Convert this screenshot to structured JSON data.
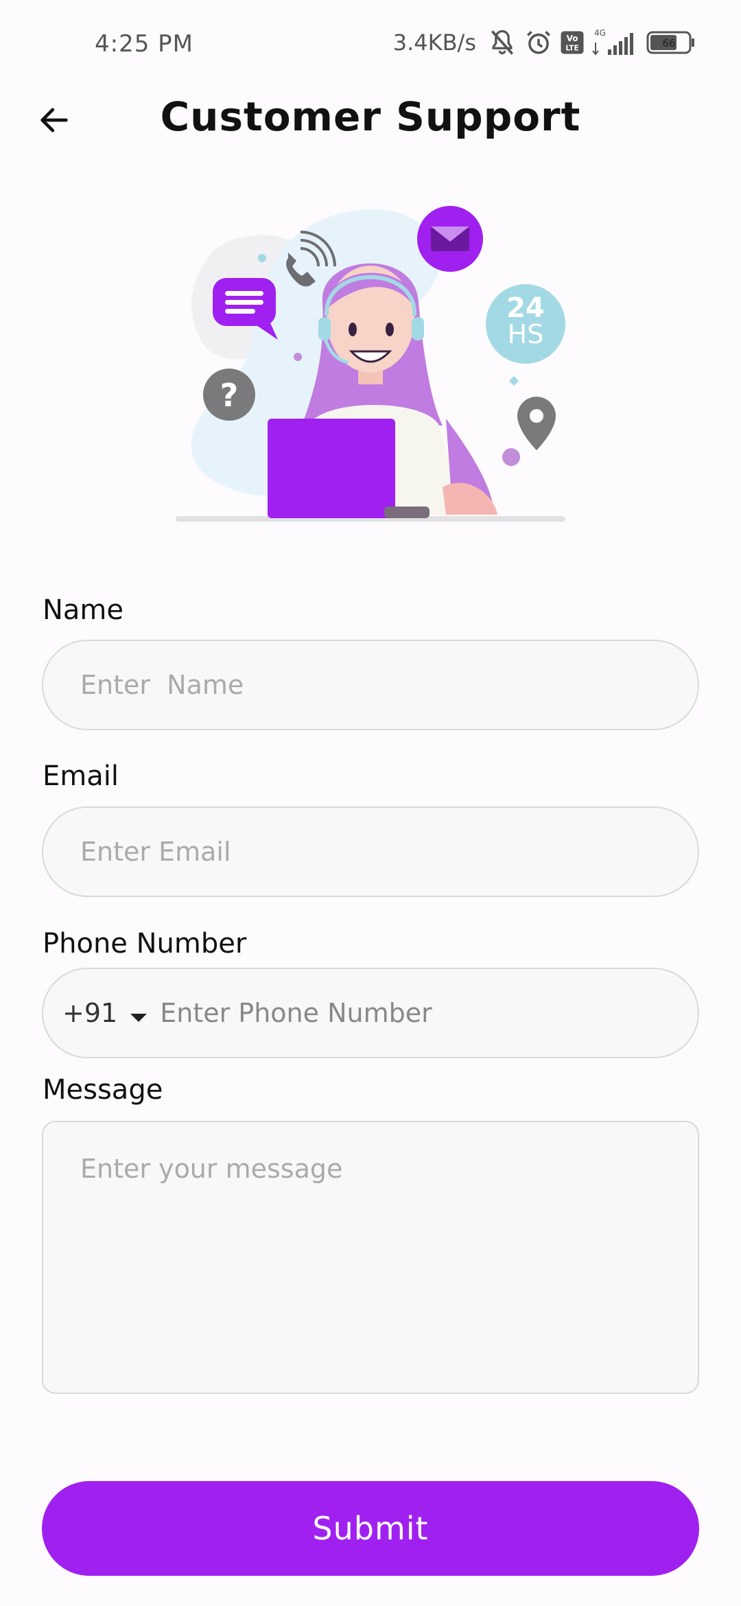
{
  "status_bar": {
    "time": "4:25 PM",
    "net_speed": "3.4KB/s",
    "network_type": "4G",
    "volte_label": "Vo LTE",
    "battery_level": "66"
  },
  "header": {
    "title": "Customer Support"
  },
  "illustration": {
    "badge_top": "24",
    "badge_bottom": "HS",
    "question_mark": "?"
  },
  "form": {
    "name": {
      "label": "Name",
      "placeholder": "Enter  Name",
      "value": ""
    },
    "email": {
      "label": "Email",
      "placeholder": "Enter Email",
      "value": ""
    },
    "phone": {
      "label": "Phone Number",
      "country_code": "+91",
      "placeholder": "Enter Phone Number",
      "value": ""
    },
    "message": {
      "label": "Message",
      "placeholder": "Enter your message",
      "value": ""
    },
    "submit_label": "Submit"
  },
  "colors": {
    "accent": "#a020f0",
    "background": "#fdfbfd",
    "field_bg": "#f7f8f7",
    "field_border": "#d8dad8"
  },
  "icons": [
    "back-arrow-icon",
    "bell-muted-icon",
    "alarm-icon",
    "volte-icon",
    "signal-icon",
    "battery-icon",
    "dropdown-caret-icon"
  ]
}
